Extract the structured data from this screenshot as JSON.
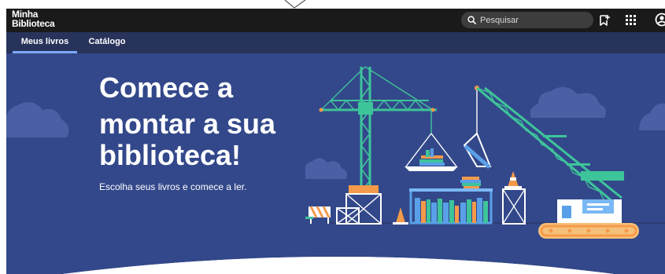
{
  "app": {
    "logo_line1": "Minha",
    "logo_line2": "Biblioteca"
  },
  "search": {
    "placeholder": "Pesquisar",
    "icon": "search-icon"
  },
  "header_icons": [
    "bookmark-add-icon",
    "apps-grid-icon",
    "account-icon"
  ],
  "tabs": [
    {
      "label": "Meus livros",
      "active": true
    },
    {
      "label": "Catálogo",
      "active": false
    }
  ],
  "hero": {
    "line1": "Comece a",
    "line2": "montar a sua",
    "line3": "biblioteca!",
    "subtitle": "Escolha seus livros e comece a ler."
  },
  "colors": {
    "top_bar": "#1a1a1a",
    "tab_bar": "#27335a",
    "hero_bg": "#33488a",
    "crane_green": "#3ec49a",
    "accent_orange": "#f59a4a",
    "active_tab_underline": "#7ca8ff"
  }
}
